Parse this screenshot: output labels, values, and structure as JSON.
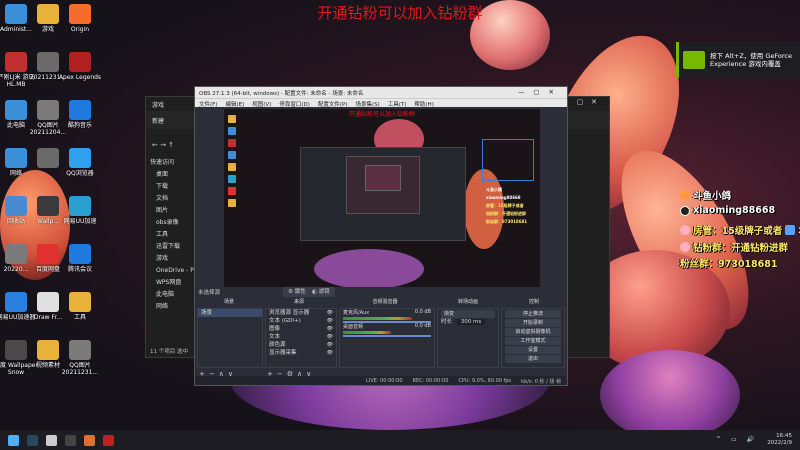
{
  "stream": {
    "title": "开通钻粉可以加入钻粉群"
  },
  "desktop": {
    "icons": [
      {
        "label": "Administ...",
        "color": "#3a8fd8"
      },
      {
        "label": "游戏",
        "color": "#e8b23a"
      },
      {
        "label": "Origin",
        "color": "#f56c2d"
      },
      {
        "label": "严刚LJ米 游玩HL.MB",
        "color": "#c03030"
      },
      {
        "label": "20211231...",
        "color": "#6a6a6a"
      },
      {
        "label": "Apex Legends",
        "color": "#b02020"
      },
      {
        "label": "此电脑",
        "color": "#3a8fd8"
      },
      {
        "label": "QQ图片 20211204...",
        "color": "#7a7a7a"
      },
      {
        "label": "酷狗音乐",
        "color": "#1f7ae0"
      },
      {
        "label": "网络",
        "color": "#3a8fd8"
      },
      {
        "label": "",
        "color": "#6a6a6a"
      },
      {
        "label": "QQ浏览器",
        "color": "#2fa0f0"
      },
      {
        "label": "回收站",
        "color": "#4a8ad0"
      },
      {
        "label": "Wallp...",
        "color": "#3a3a3a"
      },
      {
        "label": "网易UU加速",
        "color": "#2aa0d0"
      },
      {
        "label": "20220...",
        "color": "#7a7a7a"
      },
      {
        "label": "百度网盘",
        "color": "#e03030"
      },
      {
        "label": "腾讯会议",
        "color": "#1f7ae0"
      },
      {
        "label": "网易UU加速器",
        "color": "#2a80e0"
      },
      {
        "label": "Draw Fr...",
        "color": "#e0e0e0"
      },
      {
        "label": "工具",
        "color": "#e8b23a"
      },
      {
        "label": "零度 Wallpaper Snow",
        "color": "#4a4a4a"
      },
      {
        "label": "视频素材",
        "color": "#e8b23a"
      },
      {
        "label": "QQ图片 20211231...",
        "color": "#7a7a7a"
      }
    ]
  },
  "toast": {
    "line1": "按下 Alt+Z，使用 GeForce",
    "line2": "Experience 游戏内覆盖"
  },
  "overlays": {
    "douyu_name": "斗鱼小鸽",
    "tiktok": "xiaoming88668",
    "room_mgr": "房管：15级牌子或者",
    "room_mgr_suffix": "x2",
    "diamond": "钻粉群：开通钻粉进群",
    "fans_group": "粉丝群：973018681"
  },
  "explorer": {
    "title": "游戏",
    "new_btn": "新建",
    "quick_access": "快速访问",
    "nav_items": [
      "桌面",
      "下载",
      "文档",
      "图片",
      "obs录像",
      "工具",
      "迅雷下载",
      "游戏",
      "OneDrive - Perso",
      "WPS网盘",
      "此电脑",
      "网络"
    ],
    "status": "11 个项目  选中"
  },
  "obs": {
    "title": "OBS 27.1.3 (64-bit, windows) - 配置文件: 未命名 - 场景: 未命名",
    "menus": [
      "文件(F)",
      "编辑(E)",
      "视图(V)",
      "停靠窗口(D)",
      "配置文件(P)",
      "场景集(S)",
      "工具(T)",
      "帮助(H)"
    ],
    "no_source": "未选择源",
    "tab_props": "属性",
    "tab_filters": "滤镜",
    "dock_titles": [
      "场景",
      "来源",
      "音频混音器",
      "转场动画",
      "控制"
    ],
    "scenes": [
      "场景"
    ],
    "sources": [
      "浏览器源 显示器",
      "文本 (GDI+)",
      "图像",
      "文本",
      "颜色源",
      "显示器采集"
    ],
    "mixer": [
      {
        "name": "麦克风/Aux",
        "db": "0.0 dB",
        "level": 0.78
      },
      {
        "name": "桌面音频",
        "db": "0.0 dB",
        "level": 0.55
      }
    ],
    "transition": {
      "type": "渐变",
      "duration_label": "时长",
      "duration": "300 ms"
    },
    "controls": [
      "停止推流",
      "开始录制",
      "启动虚拟摄像机",
      "工作室模式",
      "设置",
      "退出"
    ],
    "status": {
      "live": "LIVE: 00:00:00",
      "rec": "REC: 00:00:00",
      "cpu": "CPU: 9.0%, 60.00 fps",
      "kbps": "kb/s: 0 秒 / 场 帧"
    }
  },
  "taskbar": {
    "apps": [
      {
        "name": "start",
        "color": "#4ab0ff"
      },
      {
        "name": "steam",
        "color": "#2a475e"
      },
      {
        "name": "search",
        "color": "#cccccc"
      },
      {
        "name": "obs",
        "color": "#444444"
      },
      {
        "name": "app-orange",
        "color": "#e07030"
      },
      {
        "name": "app-red",
        "color": "#c02020"
      }
    ],
    "time": "16:45",
    "date": "2022/2/9"
  }
}
